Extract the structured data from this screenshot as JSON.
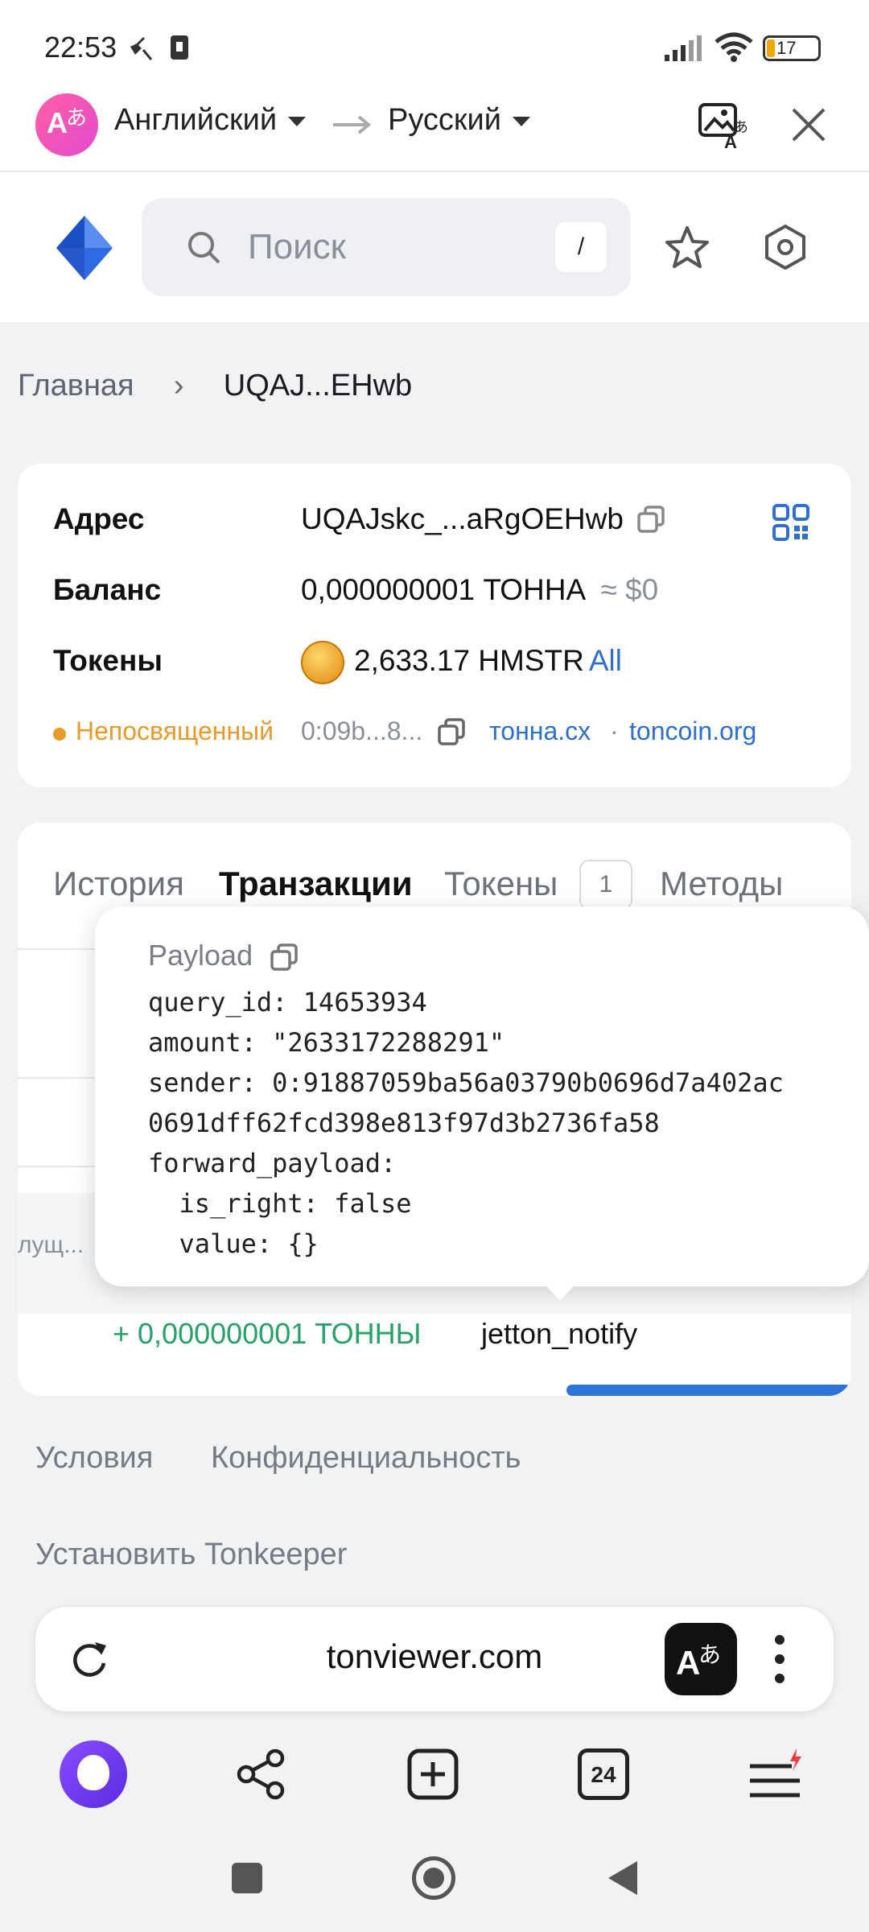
{
  "status": {
    "time": "22:53",
    "battery": "17"
  },
  "translate_bar": {
    "from_lang": "Английский",
    "to_lang": "Русский"
  },
  "search": {
    "placeholder": "Поиск",
    "shortcut": "/"
  },
  "breadcrumb": {
    "home": "Главная",
    "current": "UQAJ...EHwb"
  },
  "account": {
    "address_label": "Адрес",
    "address_value": "UQAJskc_...aRgOEHwb",
    "balance_label": "Баланс",
    "balance_value": "0,000000001 ТОННА",
    "balance_usd": "≈ $0",
    "tokens_label": "Токены",
    "tokens_value": "2,633.17 HMSTR",
    "tokens_all": "All",
    "status": "Непосвященный",
    "code_hash": "0:09b...8...",
    "link1": "тонна.сх",
    "separator": "·",
    "link2": "toncoin.org"
  },
  "tabs": {
    "history": "История",
    "transactions": "Транзакции",
    "tokens": "Токены",
    "tokens_count": "1",
    "methods": "Методы"
  },
  "popup": {
    "title": "Payload",
    "lines": [
      "query_id: 14653934",
      "amount: \"2633172288291\"",
      "sender: 0:91887059ba56a03790b0696d7a402ac",
      "0691dff62fcd398e813f97d3b2736fa58",
      "forward_payload:",
      "  is_right: false",
      "  value: {}"
    ]
  },
  "tx": {
    "side_text": "лущ...",
    "amount": "+ 0,000000001 ТОННЫ",
    "op": "jetton_notify"
  },
  "footer": {
    "terms": "Условия",
    "privacy": "Конфиденциальность",
    "install": "Установить Tonkeeper"
  },
  "browser": {
    "url": "tonviewer.com",
    "tabs_count": "24"
  },
  "colors": {
    "link": "#2e6fcf",
    "orange": "#e89a2c",
    "green": "#26a269",
    "progress": "#2e74d6",
    "alice": "#7a3cf4"
  }
}
